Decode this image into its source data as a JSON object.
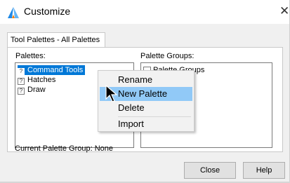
{
  "window": {
    "title": "Customize",
    "close_glyph": "✕",
    "icon": "customize-app-icon",
    "accent": "#0078d7"
  },
  "tab": {
    "label": "Tool Palettes - All Palettes"
  },
  "palettes": {
    "label": "Palettes:",
    "items": [
      {
        "label": "Command Tools",
        "icon": "palette-icon",
        "icon_glyph": "?",
        "selected": true
      },
      {
        "label": "Hatches",
        "icon": "palette-icon",
        "icon_glyph": "?",
        "selected": false
      },
      {
        "label": "Draw",
        "icon": "palette-icon",
        "icon_glyph": "?",
        "selected": false
      }
    ]
  },
  "palette_groups": {
    "label": "Palette Groups:",
    "items": [
      {
        "label": "Palette Groups",
        "icon": "folder-icon"
      }
    ]
  },
  "current_group": {
    "label": "Current Palette Group:",
    "value": "None"
  },
  "buttons": {
    "close": "Close",
    "help": "Help"
  },
  "context_menu": {
    "items": [
      {
        "label": "Rename",
        "highlighted": false
      },
      {
        "label": "New Palette",
        "highlighted": true
      },
      {
        "label": "Delete",
        "highlighted": false
      },
      {
        "label": "Import",
        "highlighted": false
      }
    ],
    "highlight_color": "#91c9f7"
  }
}
